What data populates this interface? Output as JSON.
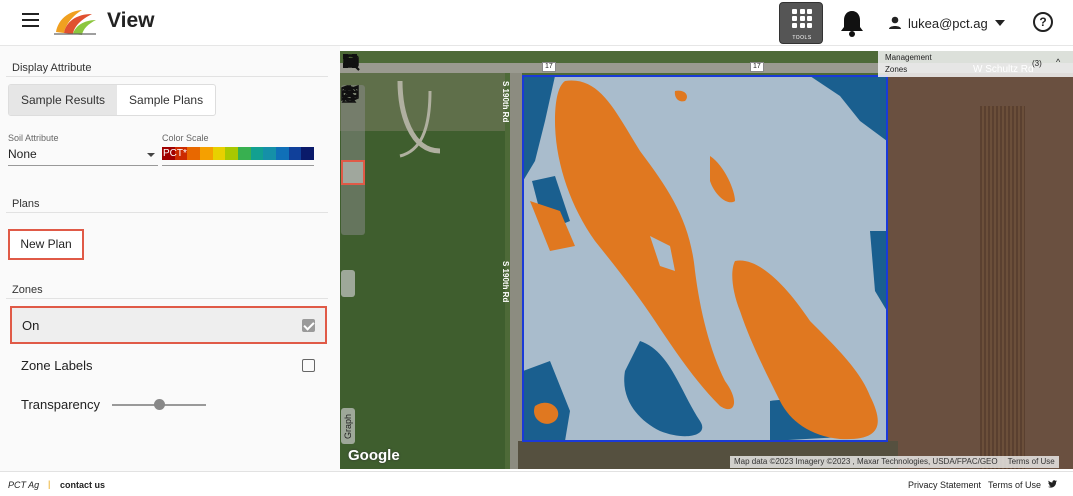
{
  "header": {
    "app_title": "View",
    "tools_label": "TOOLS",
    "user_email": "lukea@pct.ag",
    "help_glyph": "?"
  },
  "sidebar": {
    "display_attribute": {
      "label": "Display Attribute",
      "tabs": [
        "Sample Results",
        "Sample Plans"
      ],
      "active_tab": "Sample Results"
    },
    "soil_attribute": {
      "label": "Soil Attribute",
      "value": "None"
    },
    "color_scale": {
      "label": "Color Scale",
      "value": "PCT*",
      "colors": [
        "#a00000",
        "#cc2a00",
        "#e86800",
        "#f5a000",
        "#e8d000",
        "#a8c800",
        "#38b050",
        "#12a090",
        "#1590a8",
        "#1070b8",
        "#10409a",
        "#0a1a6a"
      ]
    },
    "plans": {
      "label": "Plans",
      "new_plan_label": "New Plan"
    },
    "zones": {
      "label": "Zones",
      "on_label": "On",
      "on_checked": true,
      "zone_labels_label": "Zone Labels",
      "zone_labels_checked": false,
      "transparency_label": "Transparency",
      "transparency_value": 0.5
    }
  },
  "map": {
    "management_zones_line1": "Management",
    "management_zones_line2": "Zones",
    "road_name": "W Schultz Rd",
    "zone_count": "(3)",
    "chevron": "^",
    "road_vertical": "S 190th Rd",
    "road_shield": "17",
    "graph_tab": "Graph",
    "google_label": "Google",
    "attribution": "Map data ©2023 Imagery ©2023 , Maxar Technologies, USDA/FPAC/GEO",
    "terms": "Terms of Use",
    "colors": {
      "zone_orange": "#e07820",
      "zone_blue": "#1a5f8f",
      "zone_light": "#a9bccc",
      "boundary": "#1a3ad8"
    }
  },
  "footer": {
    "brand": "PCT Ag",
    "separator": "|",
    "contact": "contact us",
    "privacy": "Privacy Statement",
    "terms": "Terms of Use",
    "twitter_icon": "twitter-icon"
  }
}
